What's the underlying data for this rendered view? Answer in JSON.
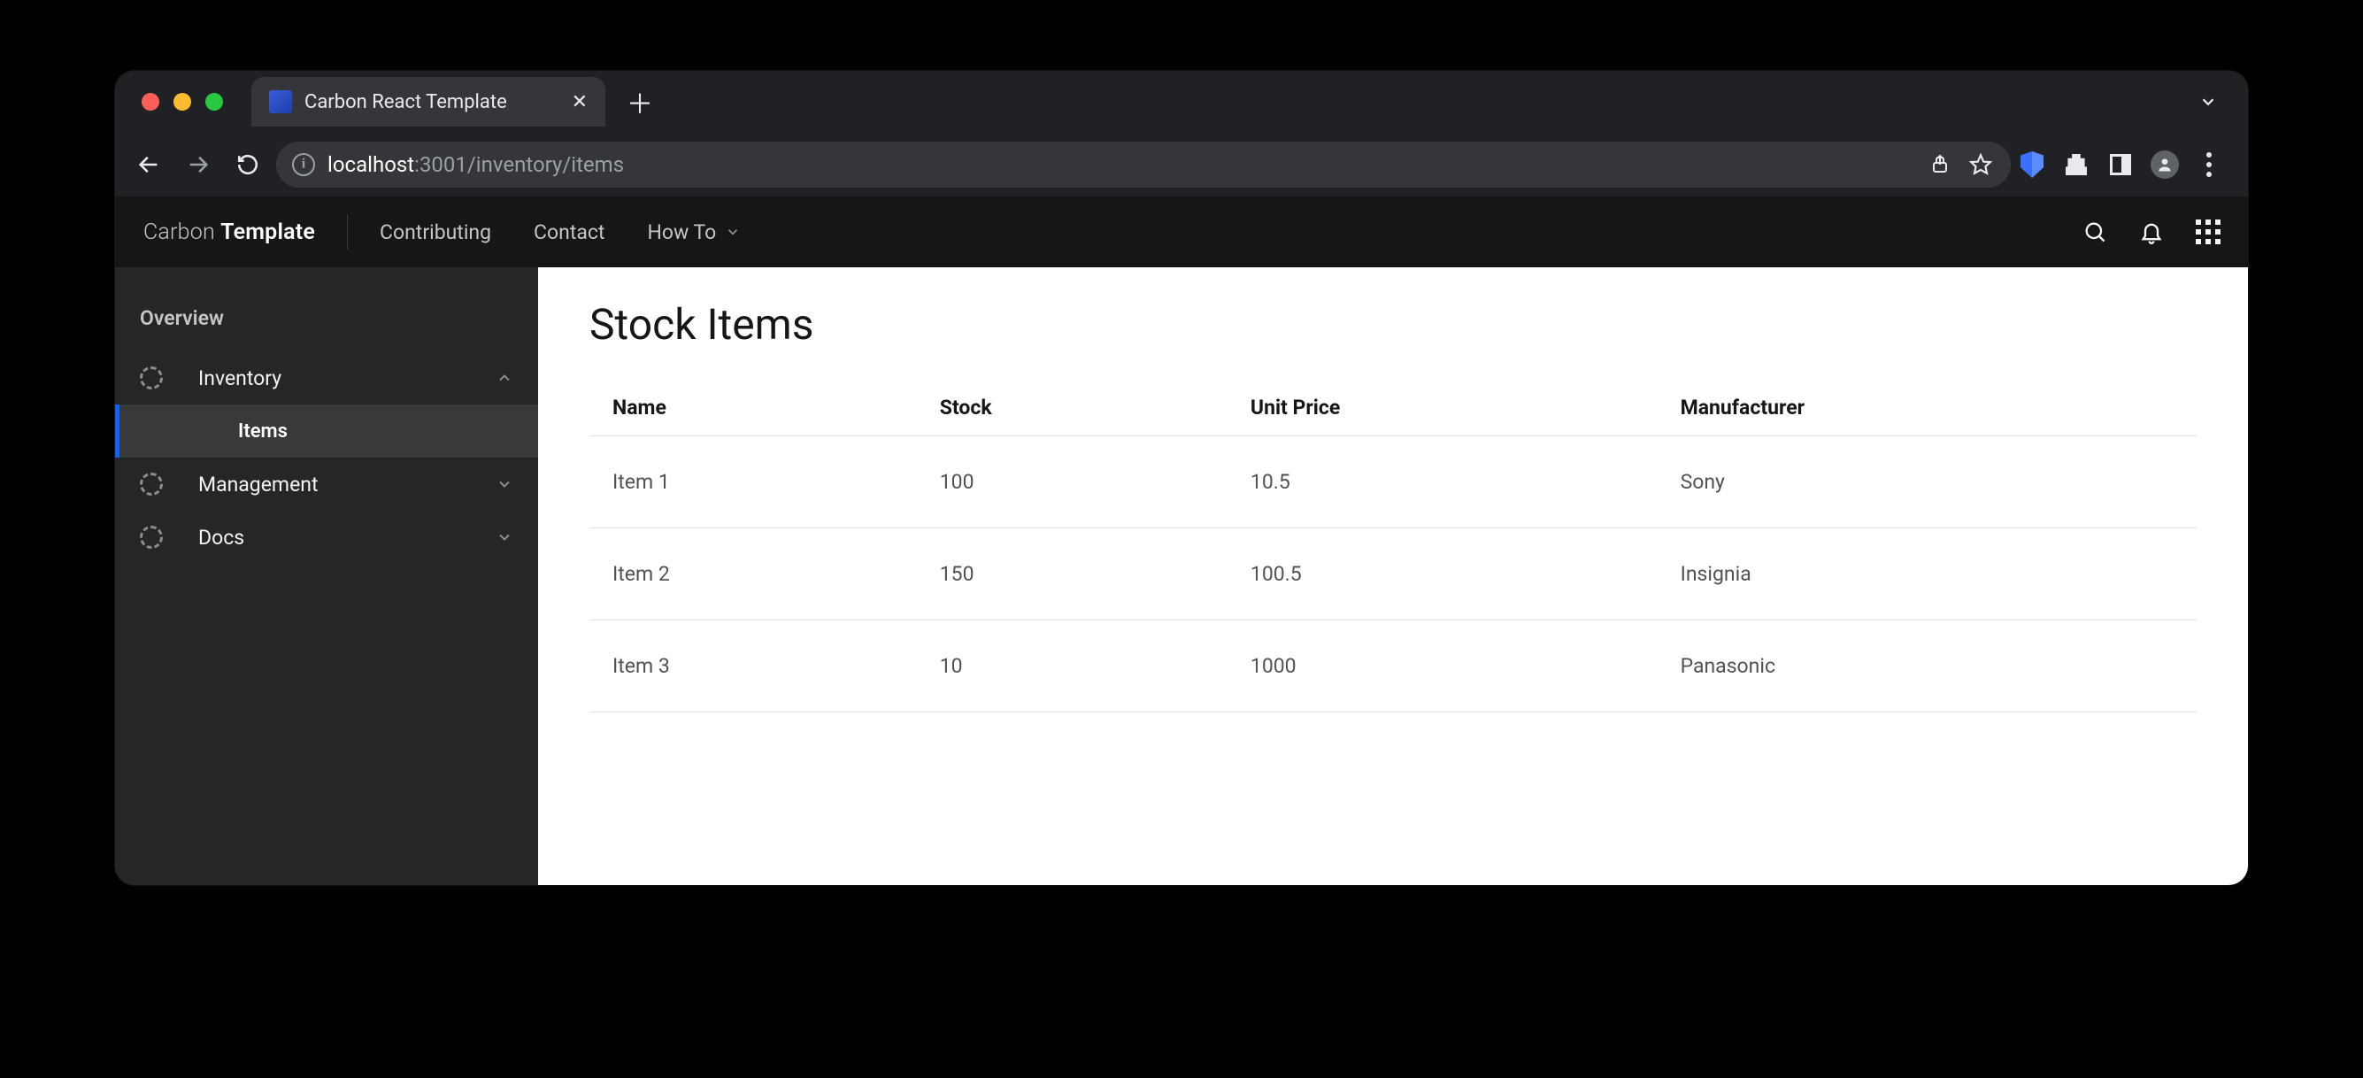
{
  "browser": {
    "tab_title": "Carbon React Template",
    "url_host": "localhost",
    "url_port_path": ":3001/inventory/items"
  },
  "header": {
    "brand_light": "Carbon ",
    "brand_bold": "Template",
    "nav": [
      "Contributing",
      "Contact",
      "How To"
    ]
  },
  "sidebar": {
    "overview": "Overview",
    "items": [
      {
        "label": "Inventory",
        "expanded": true
      },
      {
        "label": "Management",
        "expanded": false
      },
      {
        "label": "Docs",
        "expanded": false
      }
    ],
    "sub_item": "Items"
  },
  "main": {
    "title": "Stock Items",
    "columns": [
      "Name",
      "Stock",
      "Unit Price",
      "Manufacturer"
    ],
    "rows": [
      {
        "name": "Item 1",
        "stock": "100",
        "unit_price": "10.5",
        "manufacturer": "Sony"
      },
      {
        "name": "Item 2",
        "stock": "150",
        "unit_price": "100.5",
        "manufacturer": "Insignia"
      },
      {
        "name": "Item 3",
        "stock": "10",
        "unit_price": "1000",
        "manufacturer": "Panasonic"
      }
    ]
  }
}
